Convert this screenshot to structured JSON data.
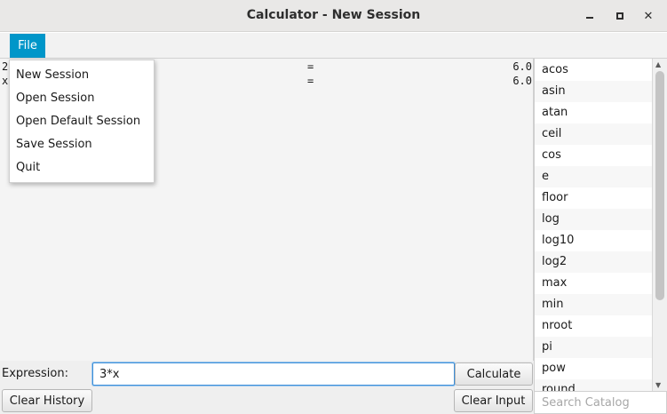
{
  "window": {
    "title": "Calculator - New Session"
  },
  "menubar": {
    "file_label": "File"
  },
  "file_menu": {
    "items": [
      "New Session",
      "Open Session",
      "Open Default Session",
      "Save Session",
      "Quit"
    ]
  },
  "history": {
    "rows": [
      {
        "expr": "2",
        "eq": "=",
        "result": "6.0"
      },
      {
        "expr": "x",
        "eq": "=",
        "result": "6.0"
      }
    ]
  },
  "catalog": {
    "items": [
      "acos",
      "asin",
      "atan",
      "ceil",
      "cos",
      "e",
      "floor",
      "log",
      "log10",
      "log2",
      "max",
      "min",
      "nroot",
      "pi",
      "pow",
      "round"
    ],
    "search_placeholder": "Search Catalog"
  },
  "input": {
    "label": "Expression:",
    "value": "3*x"
  },
  "buttons": {
    "calculate": "Calculate",
    "clear_history": "Clear History",
    "clear_input": "Clear Input"
  }
}
